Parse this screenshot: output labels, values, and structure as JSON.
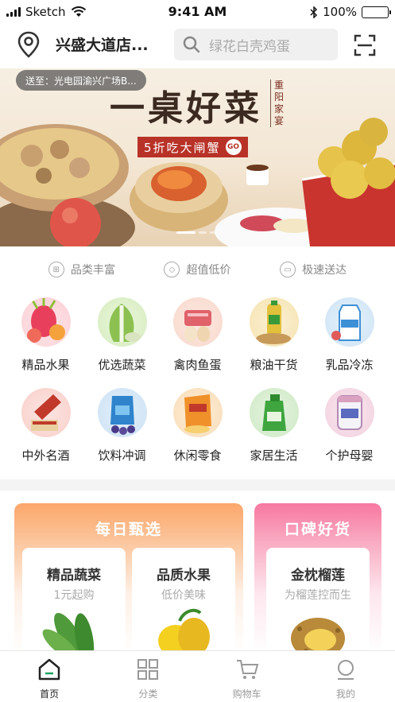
{
  "status_bar": {
    "carrier": "Sketch",
    "time": "9:41 AM",
    "battery": "100%"
  },
  "header": {
    "store_name": "兴盛大道店...",
    "search_placeholder": "绿花白壳鸡蛋"
  },
  "banner": {
    "deliver_to": "送至：光电园渝兴广场B...",
    "title": "一桌好菜",
    "side_text": "重阳家宴",
    "tag": "5折吃大闸蟹",
    "go": "GO"
  },
  "features": [
    {
      "label": "品类丰富",
      "icon": "grid-circle-icon"
    },
    {
      "label": "超值低价",
      "icon": "price-tag-icon"
    },
    {
      "label": "极速送达",
      "icon": "truck-icon"
    }
  ],
  "categories": [
    {
      "label": "精品水果",
      "icon": "fruit-icon",
      "color": "#f06a7b"
    },
    {
      "label": "优选蔬菜",
      "icon": "vegetable-icon",
      "color": "#7dbb4b"
    },
    {
      "label": "禽肉鱼蛋",
      "icon": "meat-egg-icon",
      "color": "#e07a5f"
    },
    {
      "label": "粮油干货",
      "icon": "grain-oil-icon",
      "color": "#d4a23a"
    },
    {
      "label": "乳品冷冻",
      "icon": "dairy-icon",
      "color": "#5aa4e0"
    },
    {
      "label": "中外名酒",
      "icon": "wine-icon",
      "color": "#c0392b"
    },
    {
      "label": "饮料冲调",
      "icon": "drink-icon",
      "color": "#3e8ed0"
    },
    {
      "label": "休闲零食",
      "icon": "snack-icon",
      "color": "#f0a030"
    },
    {
      "label": "家居生活",
      "icon": "home-living-icon",
      "color": "#4cae4c"
    },
    {
      "label": "个护母婴",
      "icon": "baby-care-icon",
      "color": "#d9a0c0"
    }
  ],
  "promo": {
    "daily": {
      "title": "每日甄选",
      "items": [
        {
          "name": "精品蔬菜",
          "desc": "1元起购"
        },
        {
          "name": "品质水果",
          "desc": "低价美味"
        }
      ]
    },
    "reputation": {
      "title": "口碑好货",
      "items": [
        {
          "name": "金枕榴莲",
          "desc": "为榴莲控而生"
        }
      ]
    }
  },
  "tabs": [
    {
      "label": "首页",
      "icon": "home-icon",
      "active": true
    },
    {
      "label": "分类",
      "icon": "category-grid-icon",
      "active": false
    },
    {
      "label": "购物车",
      "icon": "cart-icon",
      "active": false
    },
    {
      "label": "我的",
      "icon": "profile-icon",
      "active": false
    }
  ]
}
